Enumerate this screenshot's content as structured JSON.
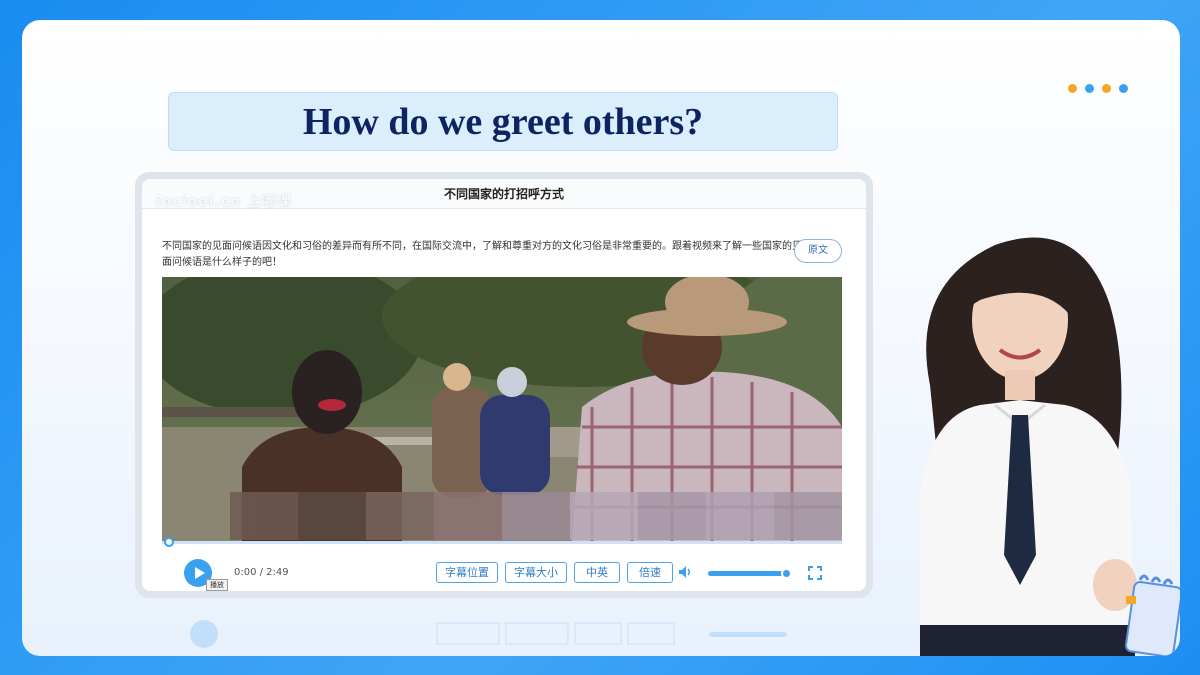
{
  "slide": {
    "title": "How do we greet others?",
    "accent_color": "#1a8cf0",
    "dot_colors": [
      "#f5a623",
      "#3aa0f0",
      "#f5a623",
      "#3aa0f0"
    ]
  },
  "player": {
    "header_title": "不同国家的打招呼方式",
    "watermark": "iocioei.cn 上哪课",
    "description": "不同国家的见面问候语因文化和习俗的差异而有所不同，在国际交流中，了解和尊重对方的文化习俗是非常重要的。跟着视频来了解一些国家的见面问候语是什么样子的吧！",
    "original_text_button": "原文",
    "video_scene": "people-greeting-outdoors",
    "progress_fraction": 0.0,
    "play_tooltip": "播放",
    "time_display": "0:00 / 2:49",
    "buttons": {
      "subtitle_position": "字幕位置",
      "subtitle_size": "字幕大小",
      "language": "中英",
      "speed": "倍速"
    },
    "volume_fraction": 0.95,
    "icons": [
      "play-icon",
      "volume-icon",
      "fullscreen-icon"
    ]
  }
}
